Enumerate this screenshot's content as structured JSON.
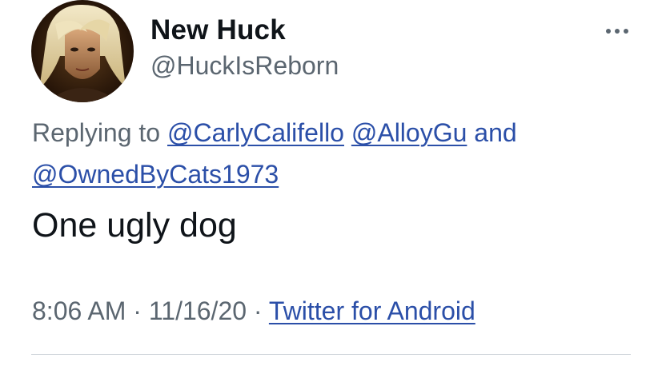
{
  "user": {
    "display_name": "New Huck",
    "handle": "@HuckIsReborn",
    "avatar_icon": "profile-portrait"
  },
  "reply": {
    "prefix": "Replying to",
    "mentions": [
      "@CarlyCalifello",
      "@AlloyGu",
      "@OwnedByCats1973"
    ],
    "joiner": "and"
  },
  "tweet": {
    "text": "One ugly dog"
  },
  "meta": {
    "time": "8:06 AM",
    "separator": "·",
    "date": "11/16/20",
    "source": "Twitter for Android"
  },
  "colors": {
    "link": "#2b4fa8",
    "muted": "#5b6670",
    "text": "#0f1419",
    "divider": "#cfd5da"
  }
}
